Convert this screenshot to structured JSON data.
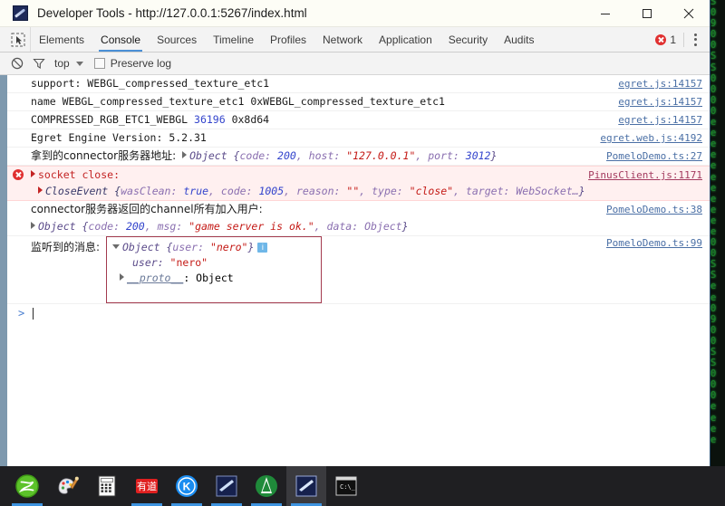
{
  "window": {
    "title": "Developer Tools - http://127.0.0.1:5267/index.html",
    "app_icon": "egret-app-icon",
    "minimize_label": "Minimize",
    "maximize_label": "Maximize",
    "close_label": "Close"
  },
  "tabs": [
    {
      "label": "Elements",
      "active": false
    },
    {
      "label": "Console",
      "active": true
    },
    {
      "label": "Sources",
      "active": false
    },
    {
      "label": "Timeline",
      "active": false
    },
    {
      "label": "Profiles",
      "active": false
    },
    {
      "label": "Network",
      "active": false
    },
    {
      "label": "Application",
      "active": false
    },
    {
      "label": "Security",
      "active": false
    },
    {
      "label": "Audits",
      "active": false
    }
  ],
  "toolbar": {
    "inspect_icon": "inspect-element-icon",
    "error_count": "1",
    "error_icon": "error-circle-icon",
    "menu_icon": "kebab-menu-icon"
  },
  "filterbar": {
    "clear_icon": "clear-console-icon",
    "filter_icon": "filter-funnel-icon",
    "context": "top",
    "context_caret": "chevron-down-icon",
    "preserve_log_label": "Preserve log",
    "preserve_log_checked": false
  },
  "console": {
    "rows": [
      {
        "text": "support: WEBGL_compressed_texture_etc1",
        "source": "egret.js:14157"
      },
      {
        "text": "name WEBGL_compressed_texture_etc1 0xWEBGL_compressed_texture_etc1",
        "source": "egret.js:14157"
      },
      {
        "prefix": "COMPRESSED_RGB_ETC1_WEBGL ",
        "number": "36196",
        "suffix": " 0x8d64",
        "source": "egret.js:14157"
      },
      {
        "text": "Egret Engine Version: 5.2.31",
        "source": "egret.web.js:4192"
      },
      {
        "label": "拿到的connector服务器地址:",
        "object_open": "Object {",
        "k1": "code: ",
        "v1": "200",
        "k2": ", host: ",
        "v2": "\"127.0.0.1\"",
        "k3": ", port: ",
        "v3": "3012",
        "object_close": "}",
        "source": "PomeloDemo.ts:27"
      }
    ],
    "error": {
      "title": "socket close:",
      "detail_obj": "CloseEvent {",
      "e_k1": "wasClean: ",
      "e_v1": "true",
      "e_k2": ", code: ",
      "e_v2": "1005",
      "e_k3": ", reason: ",
      "e_v3": "\"\"",
      "e_k4": ", type: ",
      "e_v4": "\"close\"",
      "e_k5": ", target: ",
      "e_v5": "WebSocket…",
      "e_close": "}",
      "source": "PinusClient.js:1171"
    },
    "channel_row": {
      "label": "connector服务器返回的channel所有加入用户:",
      "object_open": "Object {",
      "k1": "code: ",
      "v1": "200",
      "k2": ", msg: ",
      "v2": "\"game server is ok.\"",
      "k3": ", data: ",
      "v3": "Object",
      "object_close": "}",
      "source": "PomeloDemo.ts:38"
    },
    "message_row": {
      "label": "监听到的消息:",
      "object_header_open": "Object {",
      "hk": "user: ",
      "hv": "\"nero\"",
      "object_header_close": "}",
      "info_icon": "info-badge-icon",
      "info_glyph": "i",
      "prop_key": "user: ",
      "prop_value": "\"nero\"",
      "proto_key": "__proto__",
      "proto_sep": ": ",
      "proto_value": "Object",
      "source": "PomeloDemo.ts:99"
    },
    "prompt": {
      "caret": ">",
      "value": ""
    }
  },
  "taskbar": {
    "items": [
      {
        "name": "taskbar-icon-green-circle",
        "running": true,
        "active": false
      },
      {
        "name": "taskbar-icon-paint-palette",
        "running": false,
        "active": false
      },
      {
        "name": "taskbar-icon-calculator",
        "running": false,
        "active": false
      },
      {
        "name": "taskbar-icon-youdao",
        "running": true,
        "active": false,
        "label": "有道"
      },
      {
        "name": "taskbar-icon-kingsoft-k",
        "running": true,
        "active": false,
        "label": "K"
      },
      {
        "name": "taskbar-icon-egret-wing",
        "running": true,
        "active": false
      },
      {
        "name": "taskbar-icon-green-tree",
        "running": true,
        "active": false
      },
      {
        "name": "taskbar-icon-egret-devtools",
        "running": true,
        "active": true
      },
      {
        "name": "taskbar-icon-terminal",
        "running": false,
        "active": false
      }
    ]
  },
  "desktop": {
    "matrix_text": "S\n0\n9\n0\n0\nS\nS\n0\n0\n0\n0\ne\ne\ne\ne\ne\ne\ne\ne\ne\ne\ne\n0\n0\nS\nS\ne\ne\n0\n9\n0\n0\nS\nS\n0\n0\n0\ne\ne\ne\ne"
  }
}
